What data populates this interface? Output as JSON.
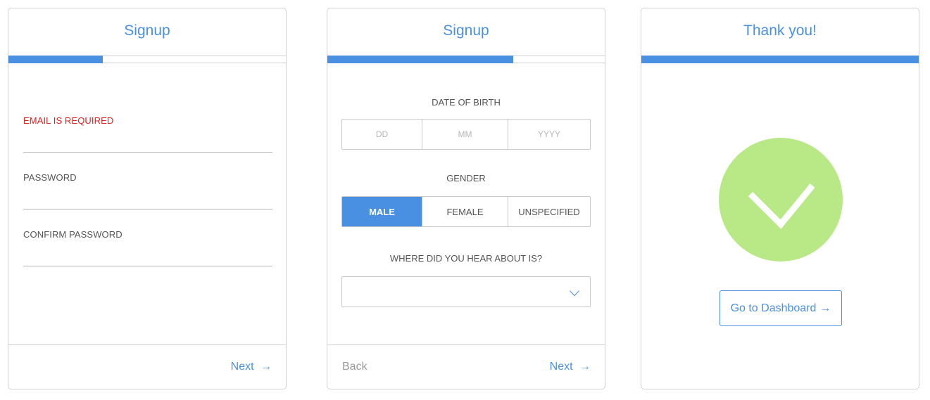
{
  "colors": {
    "accent": "#4a90e2",
    "error": "#e02020",
    "success": "#b8e986",
    "border": "#d2d2d2"
  },
  "step1": {
    "title": "Signup",
    "progress": 0.34,
    "fields": [
      {
        "label": "EMAIL IS REQUIRED",
        "state": "error",
        "value": ""
      },
      {
        "label": "PASSWORD",
        "state": "normal",
        "value": ""
      },
      {
        "label": "CONFIRM PASSWORD",
        "state": "normal",
        "value": ""
      }
    ],
    "next_label": "Next",
    "next_icon": "arrow-right-icon"
  },
  "step2": {
    "title": "Signup",
    "progress": 0.67,
    "dob_label": "DATE OF BIRTH",
    "dob_placeholders": {
      "day": "DD",
      "month": "MM",
      "year": "YYYY"
    },
    "gender_label": "GENDER",
    "gender_options": [
      "MALE",
      "FEMALE",
      "UNSPECIFIED"
    ],
    "gender_selected": "MALE",
    "source_label": "WHERE DID YOU HEAR ABOUT IS?",
    "source_value": "",
    "source_icon": "chevron-down-icon",
    "back_label": "Back",
    "next_label": "Next",
    "next_icon": "arrow-right-icon"
  },
  "step3": {
    "title": "Thank you!",
    "progress": 1.0,
    "success_icon": "checkmark-icon",
    "dashboard_label": "Go to Dashboard",
    "dashboard_icon": "arrow-right-icon"
  }
}
